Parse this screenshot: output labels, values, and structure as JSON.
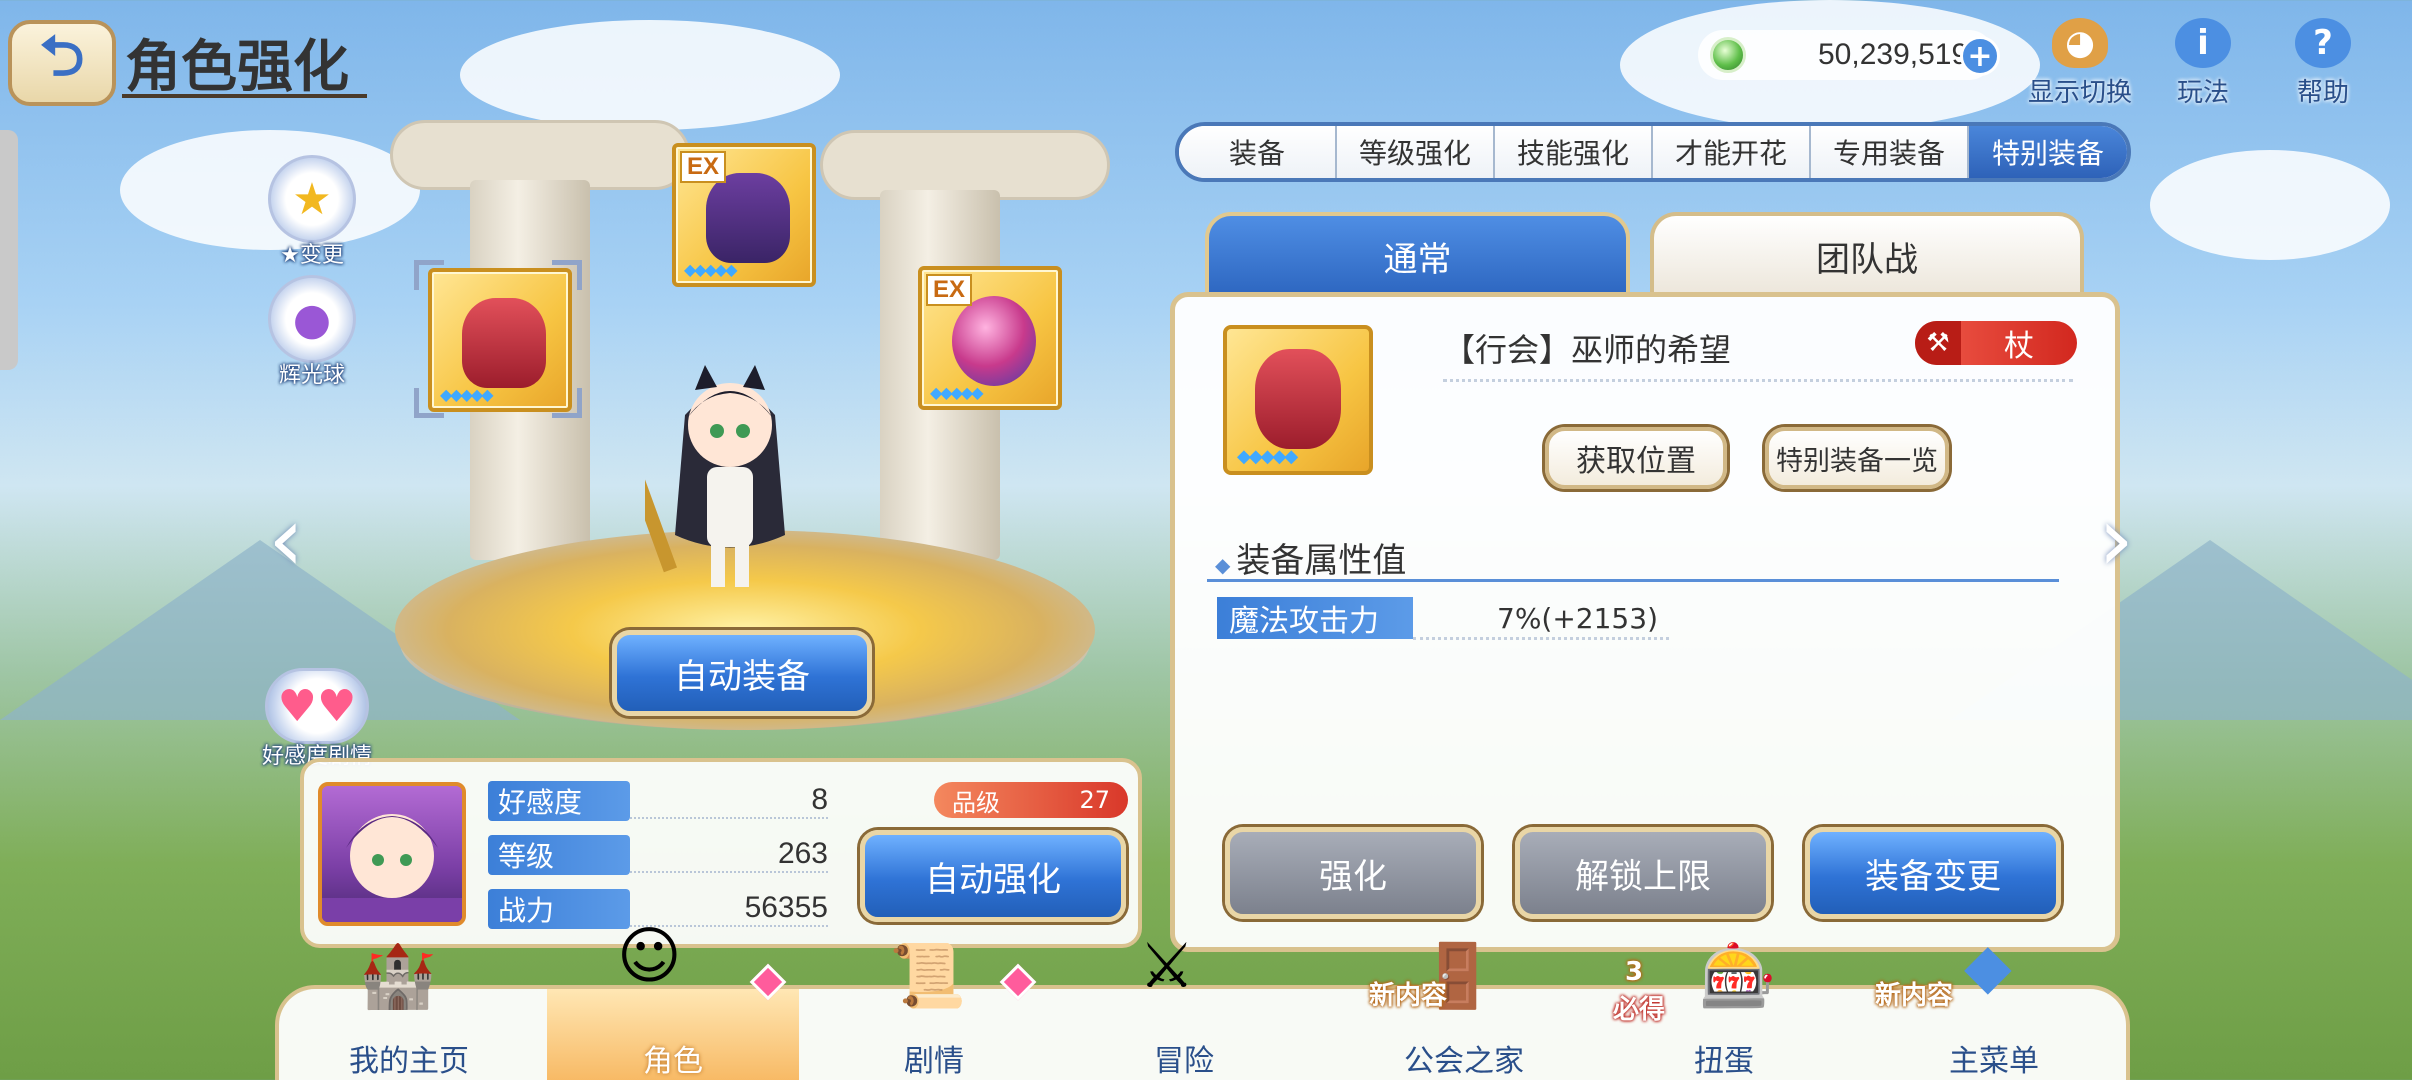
{
  "header": {
    "title": "角色强化",
    "currency_value": "50,239,519"
  },
  "top_tools": [
    {
      "label": "显示切换",
      "icon": "mascot-icon"
    },
    {
      "label": "玩法",
      "icon": "info-icon"
    },
    {
      "label": "帮助",
      "icon": "help-icon"
    }
  ],
  "tabs": [
    "装备",
    "等级强化",
    "技能强化",
    "才能开花",
    "专用装备",
    "特别装备"
  ],
  "active_tab": "特别装备",
  "side_buttons": [
    {
      "label": "★变更",
      "icon": "star-change-icon"
    },
    {
      "label": "辉光球",
      "icon": "glow-orb-icon"
    }
  ],
  "equipment_slots": [
    {
      "ex": "EX",
      "stars": "◆◆◆◆◆"
    },
    {
      "ex": "",
      "stars": "◆◆◆◆◆"
    },
    {
      "ex": "EX",
      "stars": "◆◆◆◆◆"
    }
  ],
  "auto_equip_label": "自动装备",
  "affection_story_label": "好感度剧情",
  "character": {
    "stats": [
      {
        "label": "好感度",
        "value": "8"
      },
      {
        "label": "等级",
        "value": "263"
      },
      {
        "label": "战力",
        "value": "56355"
      }
    ],
    "rank_label": "品级",
    "rank_value": "27",
    "auto_enhance_label": "自动强化"
  },
  "detail": {
    "sub_tabs": [
      "通常",
      "团队战"
    ],
    "equip_name": "【行会】巫师的希望",
    "weapon_type": "杖",
    "get_location_label": "获取位置",
    "special_list_label": "特别装备一览",
    "section_title": "装备属性值",
    "attribute": {
      "label": "魔法攻击力",
      "value": "7%(+2153)"
    },
    "buttons": {
      "enhance": "强化",
      "unlock_limit": "解锁上限",
      "change_equip": "装备变更"
    }
  },
  "bottom_nav": [
    {
      "label": "我的主页",
      "tag": ""
    },
    {
      "label": "角色",
      "tag": ""
    },
    {
      "label": "剧情",
      "tag": ""
    },
    {
      "label": "冒险",
      "tag": ""
    },
    {
      "label": "公会之家",
      "tag": "新内容"
    },
    {
      "label": "扭蛋",
      "tag": "必得",
      "count": "3"
    },
    {
      "label": "主菜单",
      "tag": "新内容"
    }
  ],
  "colors": {
    "accent_blue": "#2f73d6",
    "frame_gold": "#d9c28e",
    "rank_red": "#d9382a"
  }
}
